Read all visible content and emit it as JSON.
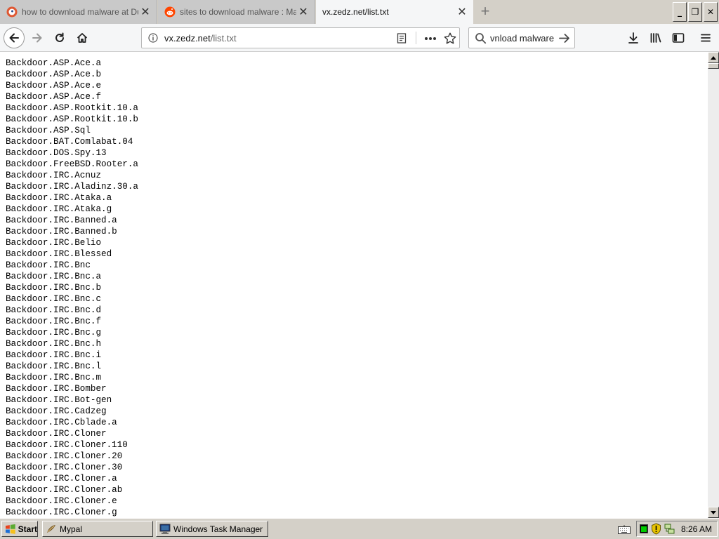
{
  "browser": {
    "tabs": [
      {
        "title": "how to download malware at DuckDuckGo",
        "icon": "duckduckgo-icon",
        "active": false
      },
      {
        "title": "sites to download malware : Malware",
        "icon": "reddit-icon",
        "active": false
      },
      {
        "title": "vx.zedz.net/list.txt",
        "icon": "",
        "active": true
      }
    ],
    "new_tab_label": "+",
    "window_controls": {
      "minimize": "_",
      "restore": "❐",
      "close": "✕"
    },
    "address": {
      "domain": "vx.zedz.net",
      "path": "/list.txt"
    },
    "search": {
      "value": "vnload malware"
    }
  },
  "content": {
    "lines": [
      "Backdoor.ASP.Ace.a",
      "Backdoor.ASP.Ace.b",
      "Backdoor.ASP.Ace.e",
      "Backdoor.ASP.Ace.f",
      "Backdoor.ASP.Rootkit.10.a",
      "Backdoor.ASP.Rootkit.10.b",
      "Backdoor.ASP.Sql",
      "Backdoor.BAT.Comlabat.04",
      "Backdoor.DOS.Spy.13",
      "Backdoor.FreeBSD.Rooter.a",
      "Backdoor.IRC.Acnuz",
      "Backdoor.IRC.Aladinz.30.a",
      "Backdoor.IRC.Ataka.a",
      "Backdoor.IRC.Ataka.g",
      "Backdoor.IRC.Banned.a",
      "Backdoor.IRC.Banned.b",
      "Backdoor.IRC.Belio",
      "Backdoor.IRC.Blessed",
      "Backdoor.IRC.Bnc",
      "Backdoor.IRC.Bnc.a",
      "Backdoor.IRC.Bnc.b",
      "Backdoor.IRC.Bnc.c",
      "Backdoor.IRC.Bnc.d",
      "Backdoor.IRC.Bnc.f",
      "Backdoor.IRC.Bnc.g",
      "Backdoor.IRC.Bnc.h",
      "Backdoor.IRC.Bnc.i",
      "Backdoor.IRC.Bnc.l",
      "Backdoor.IRC.Bnc.m",
      "Backdoor.IRC.Bomber",
      "Backdoor.IRC.Bot-gen",
      "Backdoor.IRC.Cadzeg",
      "Backdoor.IRC.Cblade.a",
      "Backdoor.IRC.Cloner",
      "Backdoor.IRC.Cloner.110",
      "Backdoor.IRC.Cloner.20",
      "Backdoor.IRC.Cloner.30",
      "Backdoor.IRC.Cloner.a",
      "Backdoor.IRC.Cloner.ab",
      "Backdoor.IRC.Cloner.e",
      "Backdoor.IRC.Cloner.g"
    ]
  },
  "taskbar": {
    "start_label": "Start",
    "tasks": [
      {
        "label": "Mypal",
        "icon": "mypal-icon"
      },
      {
        "label": "Windows Task Manager",
        "icon": "task-manager-icon"
      }
    ],
    "clock": "8:26 AM"
  },
  "colors": {
    "accent_tab": "#f5f6f7",
    "content_bg": "#ffffff",
    "chrome_bg": "#d4d0c8"
  }
}
